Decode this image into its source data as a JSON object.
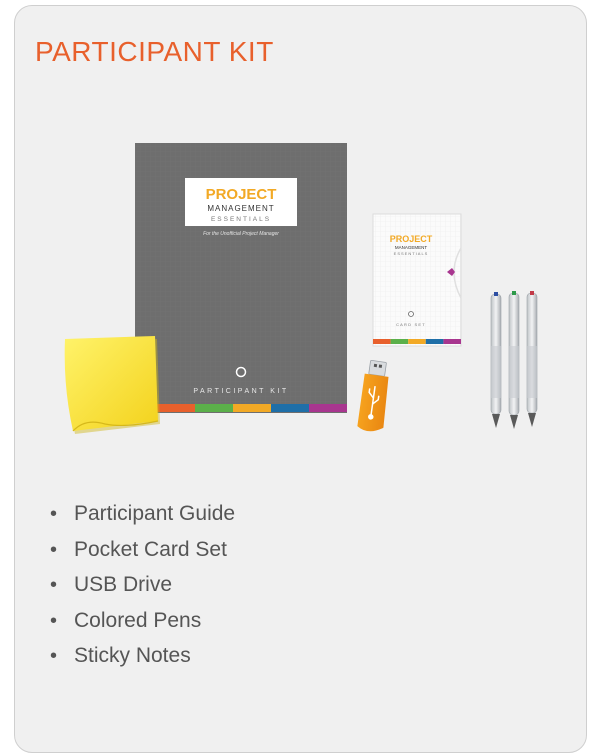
{
  "title": "PARTICIPANT KIT",
  "guide": {
    "brand_line1": "PROJECT",
    "brand_line2": "MANAGEMENT",
    "brand_line3": "ESSENTIALS",
    "tagline": "For the Unofficial Project Manager",
    "label": "PARTICIPANT KIT"
  },
  "card_set": {
    "brand_line1": "PROJECT",
    "brand_line2": "MANAGEMENT",
    "brand_line3": "ESSENTIALS",
    "label": "CARD SET"
  },
  "colors": {
    "title": "#e8602c",
    "stripe": [
      "#e8602c",
      "#5bb04a",
      "#f2a925",
      "#1f6fa8",
      "#a8368f"
    ],
    "pen_tips": [
      "#2e4fa3",
      "#2d9a4a",
      "#c23a48"
    ]
  },
  "items": [
    "Participant Guide",
    "Pocket Card Set",
    "USB Drive",
    "Colored Pens",
    "Sticky Notes"
  ]
}
